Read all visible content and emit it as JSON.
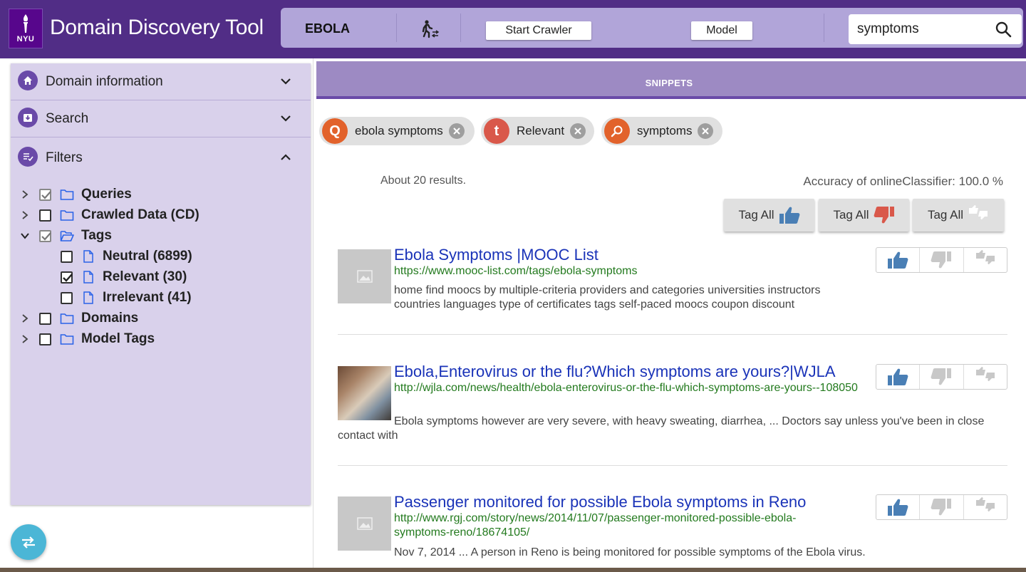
{
  "header": {
    "logo_text": "NYU",
    "title": "Domain Discovery Tool",
    "domain": "EBOLA",
    "start_crawler_label": "Start Crawler",
    "model_label": "Model",
    "search_value": "symptoms",
    "walk_icon": "person-walking-icon"
  },
  "sidebar": {
    "sections": [
      {
        "label": "Domain information",
        "icon": "home-icon",
        "expanded": false
      },
      {
        "label": "Search",
        "icon": "download-icon",
        "expanded": false
      },
      {
        "label": "Filters",
        "icon": "filter-list-icon",
        "expanded": true
      }
    ],
    "tree": [
      {
        "label": "Queries",
        "checked": true,
        "disabled": true,
        "expanded": false,
        "level": 0,
        "type": "folder"
      },
      {
        "label": "Crawled Data (CD)",
        "checked": false,
        "disabled": false,
        "expanded": false,
        "level": 0,
        "type": "folder"
      },
      {
        "label": "Tags",
        "checked": true,
        "disabled": true,
        "expanded": true,
        "level": 0,
        "type": "folder-open"
      },
      {
        "label": "Neutral (6899)",
        "checked": false,
        "disabled": false,
        "level": 1,
        "type": "file"
      },
      {
        "label": "Relevant (30)",
        "checked": true,
        "disabled": false,
        "level": 1,
        "type": "file"
      },
      {
        "label": "Irrelevant (41)",
        "checked": false,
        "disabled": false,
        "level": 1,
        "type": "file"
      },
      {
        "label": "Domains",
        "checked": false,
        "disabled": false,
        "expanded": false,
        "level": 0,
        "type": "folder"
      },
      {
        "label": "Model Tags",
        "checked": false,
        "disabled": false,
        "expanded": false,
        "level": 0,
        "type": "folder"
      }
    ]
  },
  "main": {
    "tab_label": "SNIPPETS",
    "chips": [
      {
        "avatar": "Q",
        "label": "ebola symptoms",
        "color": "#e2622b"
      },
      {
        "avatar": "t",
        "label": "Relevant",
        "color": "#d9584a"
      },
      {
        "avatar": "search-icon",
        "label": "symptoms",
        "color": "#e2622b"
      }
    ],
    "results_count": "About 20 results.",
    "accuracy": "Accuracy of onlineClassifier: 100.0 %",
    "tag_all_label": "Tag All",
    "results": [
      {
        "title": "Ebola Symptoms |MOOC List",
        "url": "https://www.mooc-list.com/tags/ebola-symptoms",
        "snippet": "home find moocs by multiple-criteria providers and categories universities instructors countries languages type of certificates tags self-paced moocs coupon discount",
        "thumb": "placeholder"
      },
      {
        "title": "Ebola,Enterovirus or the flu?Which symptoms are yours?|WJLA",
        "url": "http://wjla.com/news/health/ebola-enterovirus-or-the-flu-which-symptoms-are-yours--108050",
        "snippet": "Ebola symptoms however are very severe, with heavy sweating, diarrhea, ... Doctors say unless you've been in close contact with",
        "thumb": "photo"
      },
      {
        "title": "Passenger monitored for possible Ebola symptoms in Reno",
        "url": "http://www.rgj.com/story/news/2014/11/07/passenger-monitored-possible-ebola-symptoms-reno/18674105/",
        "snippet": "Nov 7, 2014 ... A person in Reno is being monitored for possible symptoms of the Ebola virus.",
        "thumb": "placeholder"
      }
    ]
  },
  "colors": {
    "header_bg": "#512d86",
    "toolbar_bg": "#b1a5d9",
    "sidebar_bg": "#d9d1eb",
    "tab_bg": "#9d8ac3",
    "thumbs_up": "#4a7fb5",
    "thumbs_down": "#d9584a",
    "link": "#1a33b8",
    "url": "#237a1e",
    "fab": "#4bb6d6"
  }
}
